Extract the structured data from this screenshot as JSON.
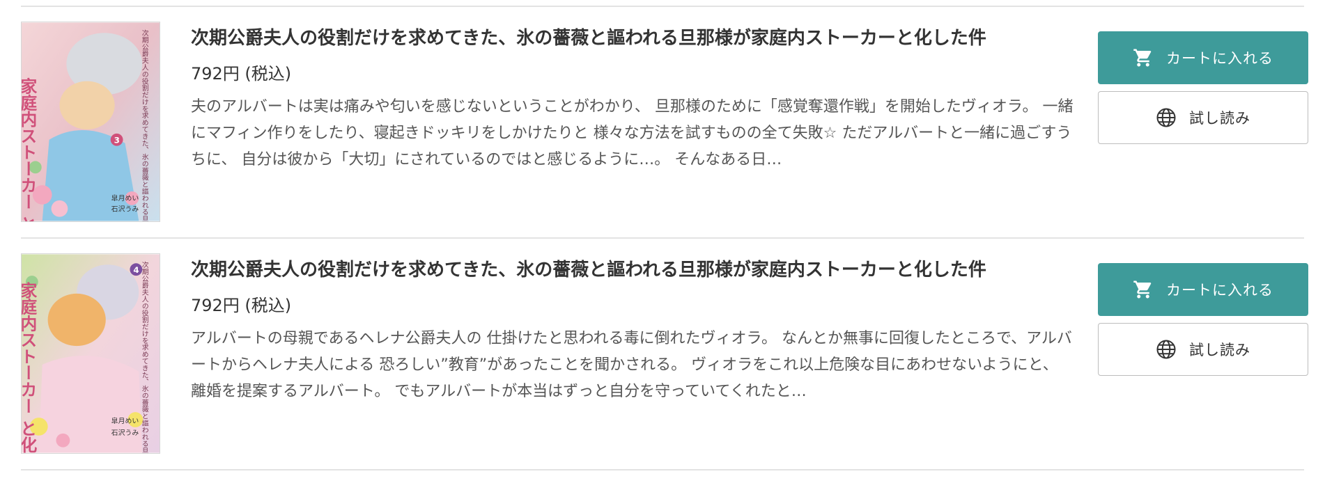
{
  "theme": {
    "accent": "#3e9b9a",
    "divider": "#e3e3e3"
  },
  "items": [
    {
      "cover": {
        "title_text": "家庭内ストーカー と化した件",
        "subtitle_text": "次期公爵夫人の役割だけを求めてきた、氷の薔薇と謳われる旦那様が",
        "volume": "3",
        "author_1": "皐月めい",
        "author_2": "石沢うみ"
      },
      "title": "次期公爵夫人の役割だけを求めてきた、氷の薔薇と謳われる旦那様が家庭内ストーカーと化した件",
      "price": "792円 (税込)",
      "description": "夫のアルバートは実は痛みや匂いを感じないということがわかり、 旦那様のために「感覚奪還作戦」を開始したヴィオラ。 一緒にマフィン作りをしたり、寝起きドッキリをしかけたりと 様々な方法を試すものの全て失敗☆ ただアルバートと一緒に過ごすうちに、 自分は彼から「大切」にされているのではと感じるように…。 そんなある日…",
      "cart_label": "カートに入れる",
      "cart_icon": "cart-icon",
      "trial_label": "試し読み",
      "trial_icon": "globe-icon"
    },
    {
      "cover": {
        "title_text": "家庭内ストーカー と化した件",
        "subtitle_text": "次期公爵夫人の役割だけを求めてきた、氷の薔薇と謳われる旦那様が",
        "volume": "4",
        "author_1": "皐月めい",
        "author_2": "石沢うみ"
      },
      "title": "次期公爵夫人の役割だけを求めてきた、氷の薔薇と謳われる旦那様が家庭内ストーカーと化した件",
      "price": "792円 (税込)",
      "description": "アルバートの母親であるヘレナ公爵夫人の 仕掛けたと思われる毒に倒れたヴィオラ。 なんとか無事に回復したところで、アルバートからヘレナ夫人による 恐ろしい”教育”があったことを聞かされる。 ヴィオラをこれ以上危険な目にあわせないようにと、 離婚を提案するアルバート。 でもアルバートが本当はずっと自分を守っていてくれたと…",
      "cart_label": "カートに入れる",
      "cart_icon": "cart-icon",
      "trial_label": "試し読み",
      "trial_icon": "globe-icon"
    }
  ]
}
